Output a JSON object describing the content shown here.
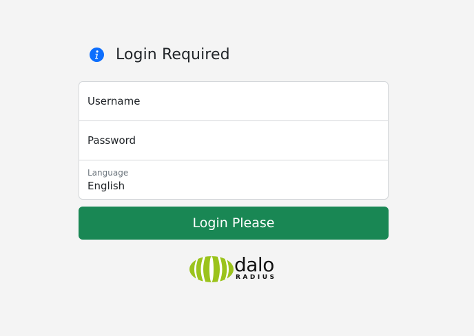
{
  "header": {
    "title": "Login Required",
    "icon": "info-icon"
  },
  "form": {
    "username_placeholder": "Username",
    "password_placeholder": "Password",
    "language_label": "Language",
    "language_value": "English",
    "submit_label": "Login Please"
  },
  "logo": {
    "text": "dalo",
    "subtext": "RADIUS"
  },
  "colors": {
    "background": "#f4f4f4",
    "accent_blue": "#0d6efd",
    "button_green": "#198754",
    "logo_green": "#9bc31c"
  }
}
